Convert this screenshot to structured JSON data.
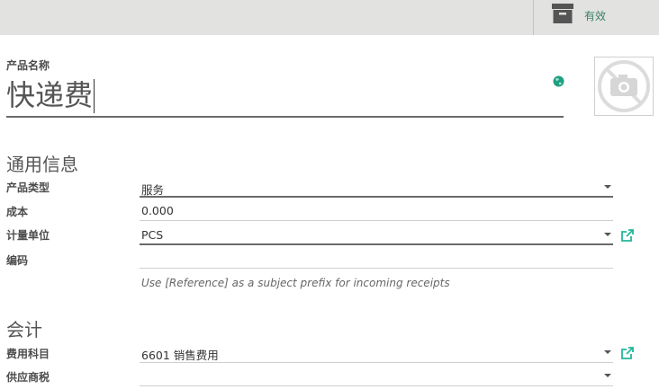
{
  "header": {
    "active_label": "有效",
    "archive_icon": "archive-box-icon"
  },
  "product": {
    "name_label": "产品名称",
    "name_value": "快递费",
    "translate_icon": "globe-icon",
    "image_placeholder_icon": "no-camera-icon"
  },
  "general_info": {
    "title": "通用信息",
    "product_type_label": "产品类型",
    "product_type_value": "服务",
    "cost_label": "成本",
    "cost_value": "0.000",
    "uom_label": "计量单位",
    "uom_value": "PCS",
    "reference_label": "编码",
    "reference_value": "",
    "reference_help": "Use [Reference] as a subject prefix for incoming receipts"
  },
  "accounting": {
    "title": "会计",
    "expense_account_label": "费用科目",
    "expense_account_value": "6601 销售费用",
    "vendor_taxes_label": "供应商税",
    "vendor_taxes_value": ""
  },
  "colors": {
    "accent": "#21b799",
    "topbar_bg": "#e2e2e0",
    "active_text": "#3b7f6b"
  }
}
